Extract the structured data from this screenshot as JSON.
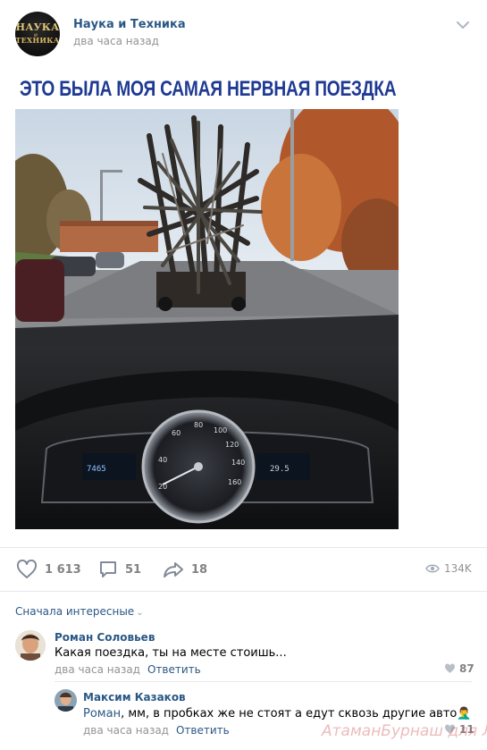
{
  "post": {
    "group_name": "Наука и Техника",
    "avatar_line1": "НАУКА",
    "avatar_mid": "и",
    "avatar_line2": "ТЕХНИКА",
    "time": "два часа назад",
    "caption": "ЭТО БЫЛА МОЯ САМАЯ НЕРВНАЯ ПОЕЗДКА",
    "dashboard_odometer": "7465",
    "dashboard_temp": "29.5",
    "likes": "1 613",
    "comments": "51",
    "shares": "18",
    "views": "134K"
  },
  "comments_section": {
    "sort_label": "Сначала интересные",
    "items": [
      {
        "author": "Роман Соловьев",
        "text": "Какая поездка, ты на месте стоишь...",
        "time": "два часа назад",
        "reply_label": "Ответить",
        "likes": "87"
      },
      {
        "author": "Максим Казаков",
        "mention": "Роман",
        "text": ", мм, в пробках же не стоят а едут сквозь другие авто",
        "emoji": "🤦‍♂️",
        "time": "два часа назад",
        "reply_label": "Ответить",
        "likes": "11"
      }
    ]
  },
  "watermark": "АтаманБурнаш для Л!",
  "colors": {
    "link": "#2a5885",
    "caption": "#1f3a93",
    "meta": "#939393",
    "separator": "#e7e8ec"
  }
}
